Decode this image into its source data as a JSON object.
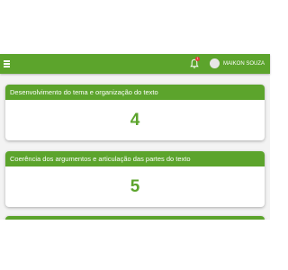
{
  "header": {
    "user_name": "MAIKON SOUZA",
    "notification_count": "1",
    "icons": [
      "menu-icon",
      "bell-icon",
      "avatar"
    ],
    "accent_color": "#5ca42c"
  },
  "cards": [
    {
      "title": "Desenvolvimento do tema e organização do texto",
      "score": "4"
    },
    {
      "title": "Coerência dos argumentos e articulação das partes do texto",
      "score": "5"
    }
  ]
}
